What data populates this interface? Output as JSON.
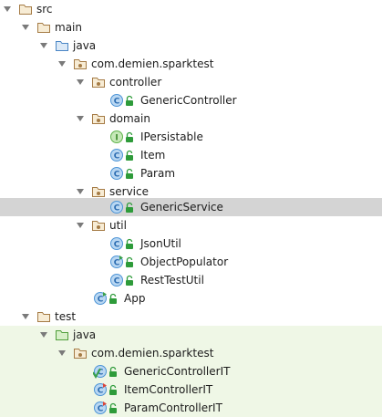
{
  "tree": {
    "items": [
      {
        "label": "src"
      },
      {
        "label": "main"
      },
      {
        "label": "java"
      },
      {
        "label": "com.demien.sparktest"
      },
      {
        "label": "controller"
      },
      {
        "label": "GenericController"
      },
      {
        "label": "domain"
      },
      {
        "label": "IPersistable"
      },
      {
        "label": "Item"
      },
      {
        "label": "Param"
      },
      {
        "label": "service"
      },
      {
        "label": "GenericService"
      },
      {
        "label": "util"
      },
      {
        "label": "JsonUtil"
      },
      {
        "label": "ObjectPopulator"
      },
      {
        "label": "RestTestUtil"
      },
      {
        "label": "App"
      },
      {
        "label": "test"
      },
      {
        "label": "java"
      },
      {
        "label": "com.demien.sparktest"
      },
      {
        "label": "GenericControllerIT"
      },
      {
        "label": "ItemControllerIT"
      },
      {
        "label": "ParamControllerIT"
      }
    ]
  },
  "icons": {
    "folder": "folder-icon",
    "source_root": "source-folder-icon",
    "test_root": "test-source-folder-icon",
    "package": "package-icon",
    "class": "class-icon",
    "interface": "interface-icon",
    "runnable_class": "runnable-class-icon",
    "test_class": "test-class-icon"
  },
  "colors": {
    "selection": "#d4d4d4",
    "test_background": "#eff7e6",
    "class_blue": "#4c94d6",
    "interface_green": "#5fb34b",
    "folder_tan": "#b08a55",
    "lock_green": "#2e9b3a"
  }
}
